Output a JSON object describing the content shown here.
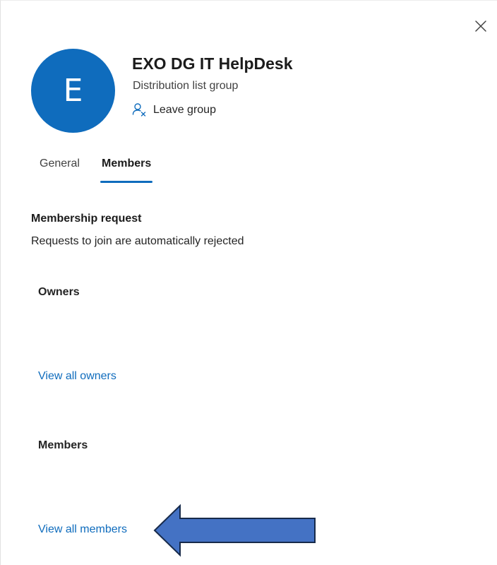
{
  "window": {
    "close_icon": "close-icon"
  },
  "group": {
    "avatar_initial": "E",
    "avatar_color": "#0f6cbd",
    "title": "EXO DG IT HelpDesk",
    "type": "Distribution list group",
    "leave_action": {
      "icon": "person-remove-icon",
      "label": "Leave group"
    }
  },
  "tabs": [
    {
      "label": "General",
      "selected": false
    },
    {
      "label": "Members",
      "selected": true
    }
  ],
  "membership_request": {
    "heading": "Membership request",
    "text": "Requests to join are automatically rejected"
  },
  "owners": {
    "heading": "Owners",
    "link": "View all owners"
  },
  "members": {
    "heading": "Members",
    "link": "View all members"
  },
  "annotation": {
    "type": "left-arrow",
    "fill_color": "#4472c4",
    "stroke_color": "#172a4a"
  },
  "colors": {
    "accent": "#0f6cbd",
    "text": "#242424"
  }
}
